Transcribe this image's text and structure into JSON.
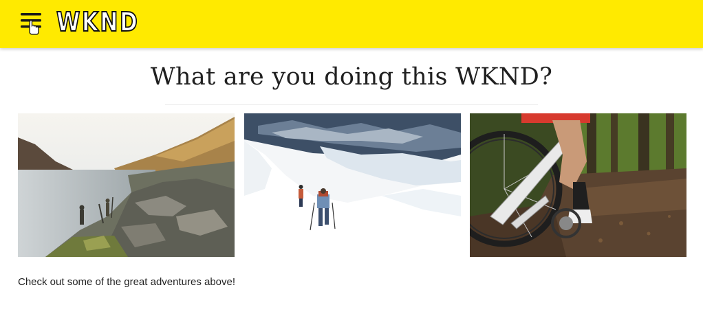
{
  "header": {
    "logo_text": "WKND",
    "background_color": "#ffea00",
    "menu_icon": "hamburger-menu-icon",
    "cursor_icon": "hand-pointer-icon"
  },
  "main": {
    "title": "What are you doing this WKND?",
    "cards": [
      {
        "image": "mountain-lake-hikers-photo"
      },
      {
        "image": "snow-glacier-trekkers-photo"
      },
      {
        "image": "forest-trail-mountain-bike-photo"
      }
    ],
    "caption": "Check out some of the great adventures above!"
  }
}
